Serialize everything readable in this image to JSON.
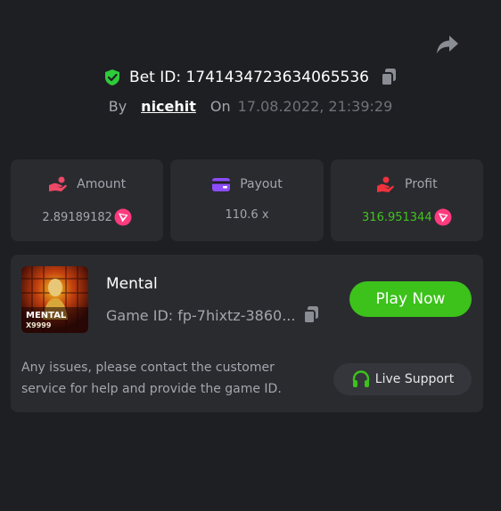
{
  "header": {
    "bet_id_label": "Bet ID: 1741434723634065536",
    "by_label": "By",
    "username": "nicehit",
    "on_label": "On",
    "datetime": "17.08.2022, 21:39:29"
  },
  "stats": {
    "amount": {
      "label": "Amount",
      "value": "2.89189182"
    },
    "payout": {
      "label": "Payout",
      "value": "110.6 x"
    },
    "profit": {
      "label": "Profit",
      "value": "316.951344"
    }
  },
  "game": {
    "name": "Mental",
    "game_id_label": "Game ID: fp-7hixtz-3860...",
    "thumb_title": "MENTAL",
    "thumb_sub": "X9999",
    "play_label": "Play Now"
  },
  "support": {
    "notice": "Any issues, please contact the customer service for help and provide the game ID.",
    "live_support_label": "Live Support"
  },
  "colors": {
    "accent_green": "#3cc21b",
    "profit_green": "#41c31e",
    "shield_green": "#2ecb3b",
    "coin_pink": "#ff3a7e",
    "payout_purple": "#8c4dfc",
    "profit_red": "#f0323c",
    "background": "#1e1f22",
    "card": "#2a2b2f"
  },
  "icons": [
    "share-icon",
    "shield-check-icon",
    "copy-icon",
    "amount-icon",
    "wallet-icon",
    "profit-icon",
    "tron-coin-icon",
    "headset-icon"
  ]
}
